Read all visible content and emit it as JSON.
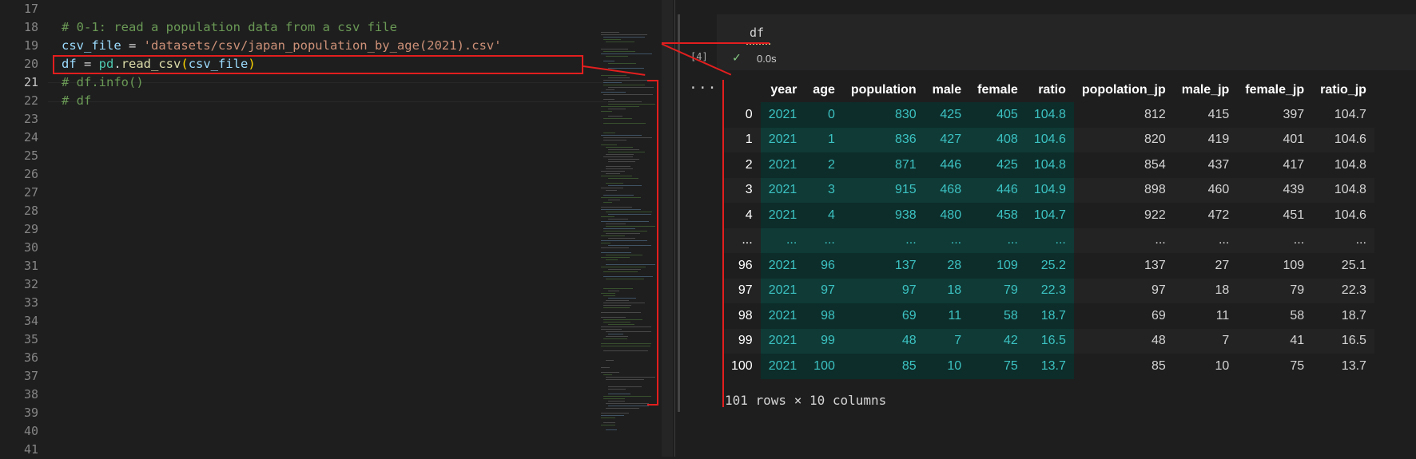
{
  "editor": {
    "lines": [
      {
        "num": "17",
        "code": ""
      },
      {
        "num": "18",
        "code": "# 0-1: read a population data from a csv file"
      },
      {
        "num": "19",
        "code": "csv_file = 'datasets/csv/japan_population_by_age(2021).csv'"
      },
      {
        "num": "20",
        "code": "df = pd.read_csv(csv_file)"
      },
      {
        "num": "21",
        "code": "# df.info()"
      },
      {
        "num": "22",
        "code": "# df"
      },
      {
        "num": "23",
        "code": ""
      },
      {
        "num": "24",
        "code": ""
      },
      {
        "num": "25",
        "code": ""
      },
      {
        "num": "26",
        "code": ""
      },
      {
        "num": "27",
        "code": ""
      },
      {
        "num": "28",
        "code": ""
      },
      {
        "num": "29",
        "code": ""
      },
      {
        "num": "30",
        "code": ""
      },
      {
        "num": "31",
        "code": ""
      },
      {
        "num": "32",
        "code": ""
      },
      {
        "num": "33",
        "code": ""
      },
      {
        "num": "34",
        "code": ""
      },
      {
        "num": "35",
        "code": ""
      },
      {
        "num": "36",
        "code": ""
      },
      {
        "num": "37",
        "code": ""
      },
      {
        "num": "38",
        "code": ""
      },
      {
        "num": "39",
        "code": ""
      },
      {
        "num": "40",
        "code": ""
      },
      {
        "num": "41",
        "code": ""
      }
    ],
    "tokens": {
      "l18": "# 0-1: read a population data from a csv file",
      "l19_var": "csv_file",
      "l19_eq": " = ",
      "l19_str": "'datasets/csv/japan_population_by_age(2021).csv'",
      "l20_var": "df",
      "l20_eq": " = ",
      "l20_mod": "pd",
      "l20_dot": ".",
      "l20_fn": "read_csv",
      "l20_po": "(",
      "l20_arg": "csv_file",
      "l20_pc": ")",
      "l21": "# df.info()",
      "l22": "# df"
    }
  },
  "cell": {
    "code": "df",
    "execution_count": "[4]",
    "exec_time": "0.0s",
    "output_menu": "...",
    "status_icon": "check-icon"
  },
  "table": {
    "columns": [
      "",
      "year",
      "age",
      "population",
      "male",
      "female",
      "ratio",
      "popolation_jp",
      "male_jp",
      "female_jp",
      "ratio_jp"
    ],
    "rows": [
      [
        "0",
        "2021",
        "0",
        "830",
        "425",
        "405",
        "104.8",
        "812",
        "415",
        "397",
        "104.7"
      ],
      [
        "1",
        "2021",
        "1",
        "836",
        "427",
        "408",
        "104.6",
        "820",
        "419",
        "401",
        "104.6"
      ],
      [
        "2",
        "2021",
        "2",
        "871",
        "446",
        "425",
        "104.8",
        "854",
        "437",
        "417",
        "104.8"
      ],
      [
        "3",
        "2021",
        "3",
        "915",
        "468",
        "446",
        "104.9",
        "898",
        "460",
        "439",
        "104.8"
      ],
      [
        "4",
        "2021",
        "4",
        "938",
        "480",
        "458",
        "104.7",
        "922",
        "472",
        "451",
        "104.6"
      ],
      [
        "...",
        "...",
        "...",
        "...",
        "...",
        "...",
        "...",
        "...",
        "...",
        "...",
        "..."
      ],
      [
        "96",
        "2021",
        "96",
        "137",
        "28",
        "109",
        "25.2",
        "137",
        "27",
        "109",
        "25.1"
      ],
      [
        "97",
        "2021",
        "97",
        "97",
        "18",
        "79",
        "22.3",
        "97",
        "18",
        "79",
        "22.3"
      ],
      [
        "98",
        "2021",
        "98",
        "69",
        "11",
        "58",
        "18.7",
        "69",
        "11",
        "58",
        "18.7"
      ],
      [
        "99",
        "2021",
        "99",
        "48",
        "7",
        "42",
        "16.5",
        "48",
        "7",
        "41",
        "16.5"
      ],
      [
        "100",
        "2021",
        "100",
        "85",
        "10",
        "75",
        "13.7",
        "85",
        "10",
        "75",
        "13.7"
      ]
    ],
    "shape": "101 rows × 10 columns"
  },
  "colors": {
    "annotation": "#e31e1e",
    "highlight_column_text": "#3cc2c2",
    "comment": "#6a9955",
    "string": "#ce9178"
  }
}
